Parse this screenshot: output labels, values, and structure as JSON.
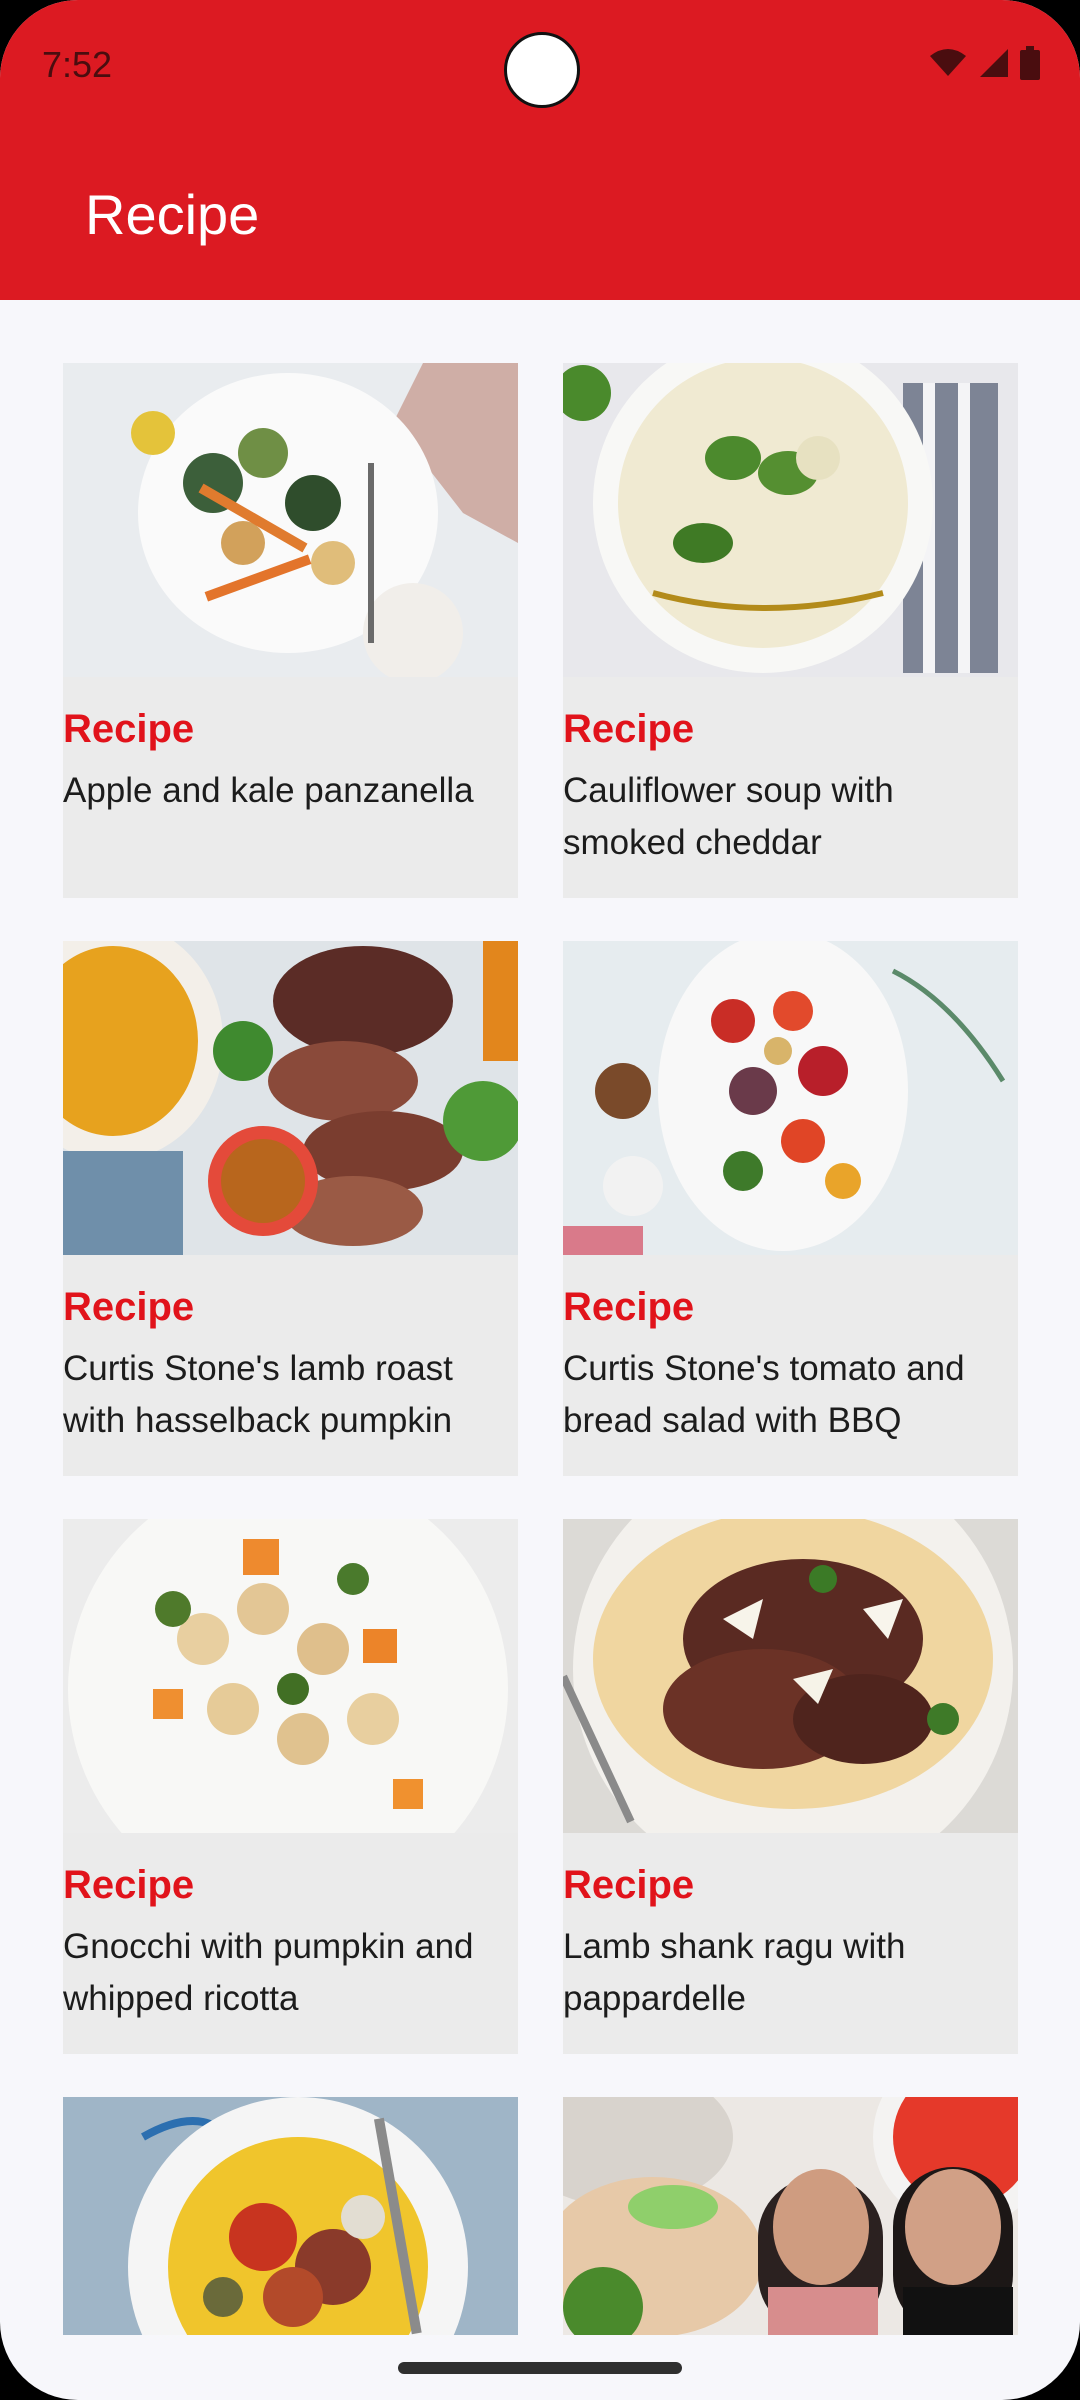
{
  "status": {
    "time": "7:52"
  },
  "appbar": {
    "title": "Recipe"
  },
  "cards": [
    {
      "label": "Recipe",
      "title": "Apple and kale panzanella"
    },
    {
      "label": "Recipe",
      "title": "Cauliflower soup with smoked cheddar"
    },
    {
      "label": "Recipe",
      "title": "Curtis Stone's lamb roast with hasselback pumpkin"
    },
    {
      "label": "Recipe",
      "title": "Curtis Stone's tomato and bread salad with BBQ"
    },
    {
      "label": "Recipe",
      "title": "Gnocchi with pumpkin and whipped ricotta"
    },
    {
      "label": "Recipe",
      "title": "Lamb shank ragu with pappardelle"
    }
  ],
  "colors": {
    "appbar": "#dc1a22",
    "accent": "#e1131b",
    "card": "#ebebeb",
    "background": "#f7f7fb"
  }
}
